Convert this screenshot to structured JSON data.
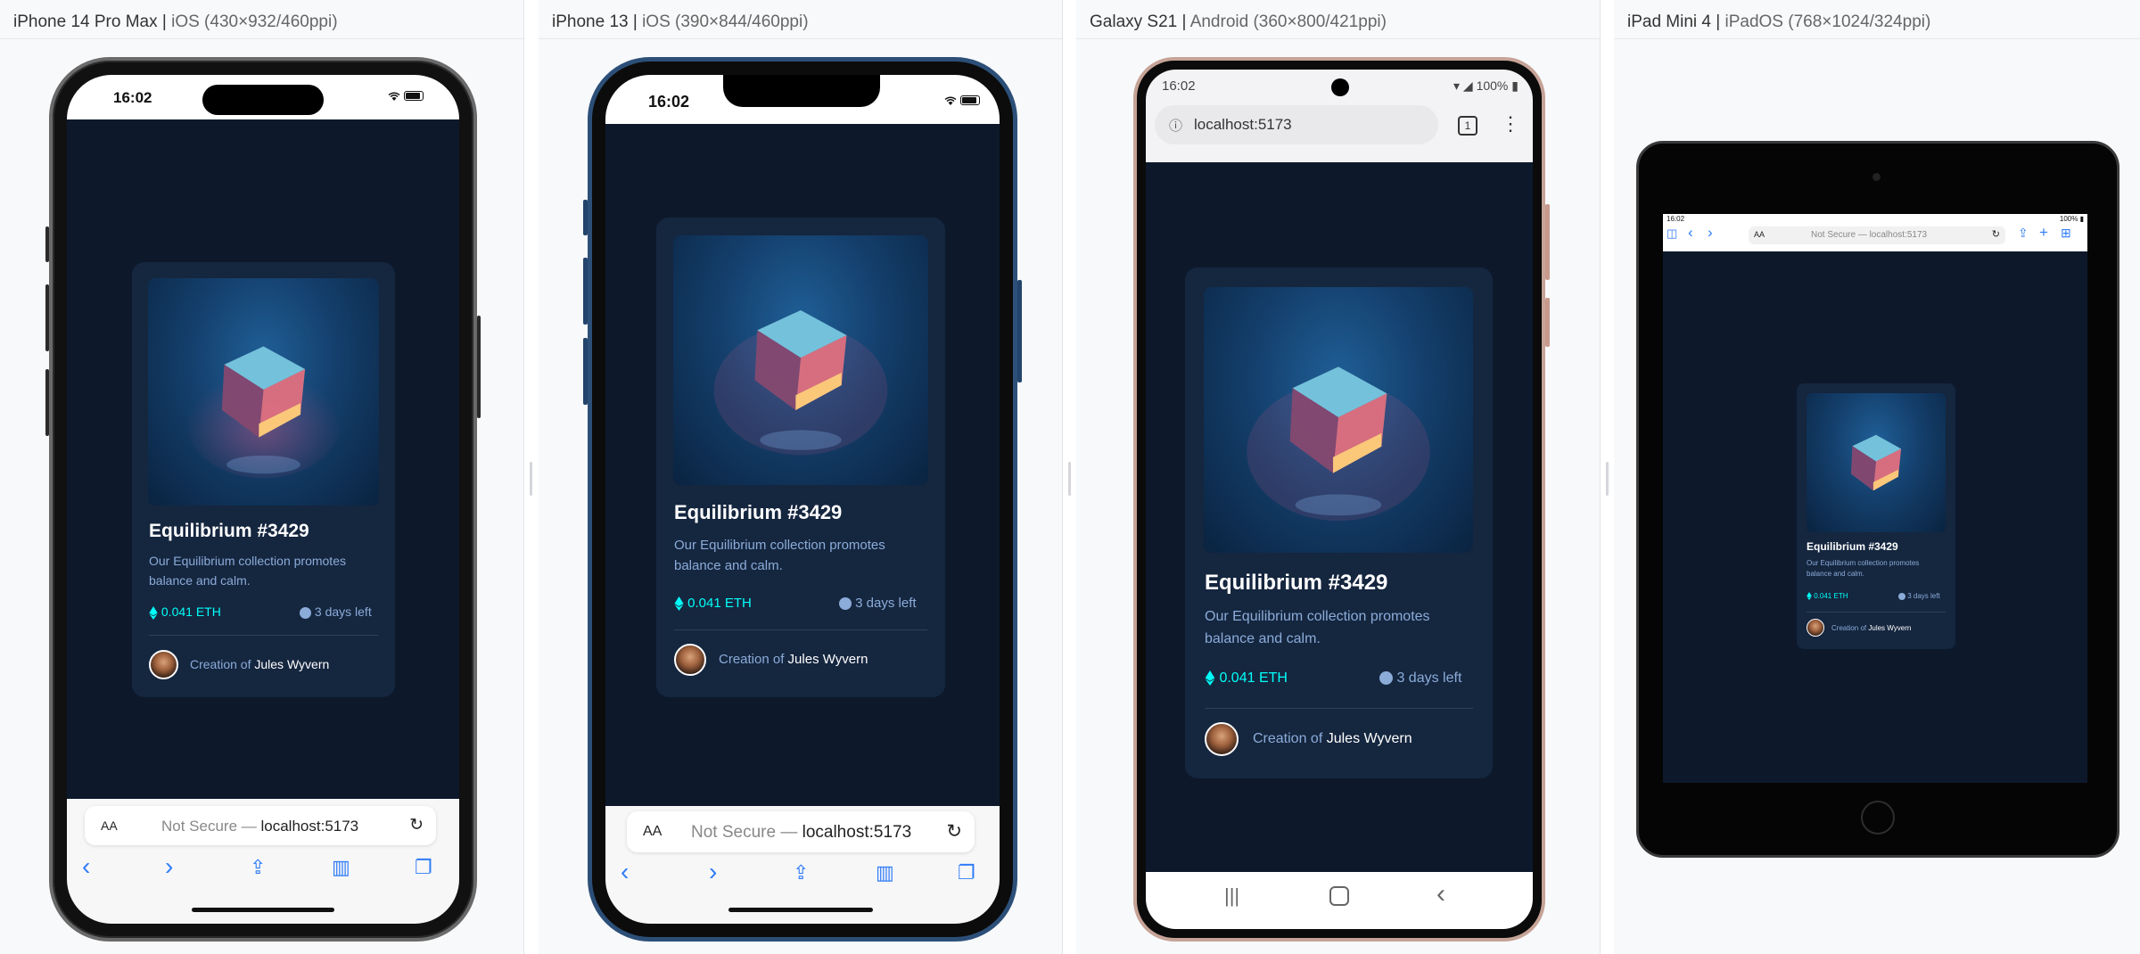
{
  "devices": [
    {
      "name": "iPhone 14 Pro Max",
      "spec": "iOS (430×932/460ppi)"
    },
    {
      "name": "iPhone 13",
      "spec": "iOS (390×844/460ppi)"
    },
    {
      "name": "Galaxy S21",
      "spec": "Android (360×800/421ppi)"
    },
    {
      "name": "iPad Mini 4",
      "spec": "iPadOS (768×1024/324ppi)"
    }
  ],
  "status": {
    "time_iphone14": "16:02",
    "time_iphone13": "16:02",
    "time_galaxy": "16:02",
    "battery_galaxy": "100%",
    "time_ipad": "16:02",
    "battery_ipad": "100%"
  },
  "card": {
    "title": "Equilibrium #3429",
    "description": "Our Equilibrium collection promotes balance and calm.",
    "price": "0.041 ETH",
    "time_left": "3 days left",
    "creation_prefix": "Creation of",
    "creator_name": "Jules Wyvern"
  },
  "browser": {
    "aa_label": "AA",
    "not_secure": "Not Secure —",
    "url": "localhost:5173",
    "tab_count": "1",
    "ipad_url": "Not Secure — localhost:5173"
  },
  "colors": {
    "background": "#0d192b",
    "card": "#15263f",
    "cyan": "#00fff8",
    "soft_blue": "#8bacd9",
    "safari_blue": "#2f7cf6"
  }
}
